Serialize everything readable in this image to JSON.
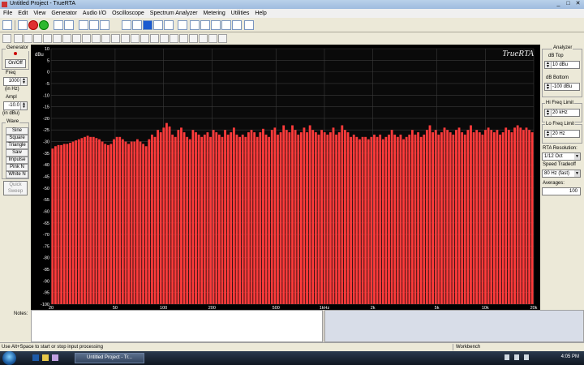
{
  "window": {
    "title": "Untitled Project - TrueRTA",
    "controls": [
      "_",
      "□",
      "✕"
    ]
  },
  "menu": [
    "File",
    "Edit",
    "View",
    "Generator",
    "Audio I/O",
    "Oscilloscope",
    "Spectrum Analyzer",
    "Metering",
    "Utilities",
    "Help"
  ],
  "generator": {
    "group_label": "Generator",
    "onoff_label": "On/Off",
    "freq_label": "Freq",
    "freq_value": "1000",
    "freq_unit": "(in Hz)",
    "ampl_label": "Ampl",
    "ampl_value": "-10.0",
    "ampl_unit": "(in dBu)",
    "wave_label": "Wave",
    "waves": [
      "Sine",
      "Square",
      "Triangle",
      "Saw",
      "Impulse",
      "Pink N",
      "White N"
    ],
    "quick_sweep": "Quick Sweep"
  },
  "analyzer": {
    "group_label": "Analyzer",
    "db_top_label": "dB Top",
    "db_top_value": "10 dBu",
    "db_bottom_label": "dB Bottom",
    "db_bottom_value": "-100 dBu",
    "hi_freq_label": "Hi Freq Limit",
    "hi_freq_value": "20 kHz",
    "lo_freq_label": "Lo Freq Limit",
    "lo_freq_value": "20 Hz",
    "rta_res_label": "RTA Resolution:",
    "rta_res_value": "1/12 Oct",
    "speed_label": "Speed Tradeoff",
    "speed_value": "80 Hz (fast)",
    "averages_label": "Averages:",
    "averages_value": "100"
  },
  "notes": {
    "label": "Notes:"
  },
  "status": {
    "left": "Use Alt+Space to start or stop input processing",
    "right": "Workbench"
  },
  "taskbar": {
    "item": "Untitled Project - Tr...",
    "clock": "4:05 PM"
  },
  "colors": {
    "bar": "#ff3b3b",
    "plot_bg": "#000000",
    "grid": "#3a3a3a"
  },
  "chart_data": {
    "type": "bar",
    "brand": "TrueRTA",
    "ylabel": "dBu",
    "ylim": [
      -100,
      10
    ],
    "yticks": [
      10,
      5,
      0,
      -5,
      -10,
      -15,
      -20,
      -25,
      -30,
      -35,
      -40,
      -45,
      -50,
      -55,
      -60,
      -65,
      -70,
      -75,
      -80,
      -85,
      -90,
      -95,
      -100
    ],
    "xscale": "log",
    "xlim": [
      20,
      20000
    ],
    "xticks": [
      {
        "label": "20",
        "f": 20
      },
      {
        "label": "50",
        "f": 50
      },
      {
        "label": "100",
        "f": 100
      },
      {
        "label": "200",
        "f": 200
      },
      {
        "label": "500",
        "f": 500
      },
      {
        "label": "1kHz",
        "f": 1000
      },
      {
        "label": "2k",
        "f": 2000
      },
      {
        "label": "5k",
        "f": 5000
      },
      {
        "label": "10k",
        "f": 10000
      },
      {
        "label": "20k",
        "f": 20000
      }
    ],
    "series": [
      {
        "values": [
          -33,
          -32,
          -31.5,
          -31.5,
          -31,
          -31,
          -30.5,
          -30,
          -29.5,
          -29,
          -28.5,
          -28,
          -27.5,
          -28,
          -28,
          -28.5,
          -29,
          -30,
          -31,
          -31.5,
          -31,
          -29,
          -28,
          -28,
          -29,
          -30,
          -31,
          -30,
          -30,
          -29,
          -30,
          -31,
          -32,
          -29,
          -27,
          -28,
          -25,
          -26,
          -24,
          -22,
          -23.5,
          -27,
          -28,
          -25,
          -24,
          -26,
          -28,
          -29,
          -25,
          -26,
          -27,
          -28,
          -27,
          -26,
          -28,
          -25,
          -26,
          -27,
          -28,
          -25,
          -27,
          -26,
          -24,
          -27,
          -28,
          -27,
          -28,
          -26,
          -25,
          -26,
          -28,
          -26,
          -24.5,
          -27,
          -28,
          -25,
          -24,
          -27,
          -26,
          -23,
          -25,
          -26,
          -23,
          -25,
          -27,
          -26,
          -24,
          -26,
          -23,
          -25,
          -26,
          -27,
          -25,
          -26,
          -27,
          -26,
          -24,
          -27,
          -26,
          -23,
          -25,
          -26,
          -28,
          -27,
          -28,
          -29,
          -28,
          -28,
          -29,
          -28,
          -27,
          -28,
          -27,
          -29,
          -28,
          -27,
          -25,
          -27,
          -28,
          -27,
          -29,
          -28,
          -27,
          -25,
          -27,
          -26,
          -28,
          -27,
          -25,
          -23,
          -26,
          -25,
          -27,
          -26,
          -24,
          -25,
          -26,
          -27,
          -25,
          -24,
          -26,
          -27,
          -25,
          -23,
          -26,
          -25,
          -26,
          -27,
          -25,
          -24,
          -25,
          -26,
          -25,
          -27,
          -26,
          -24,
          -25,
          -26,
          -24,
          -23,
          -24,
          -25,
          -24,
          -25,
          -26
        ]
      }
    ]
  }
}
